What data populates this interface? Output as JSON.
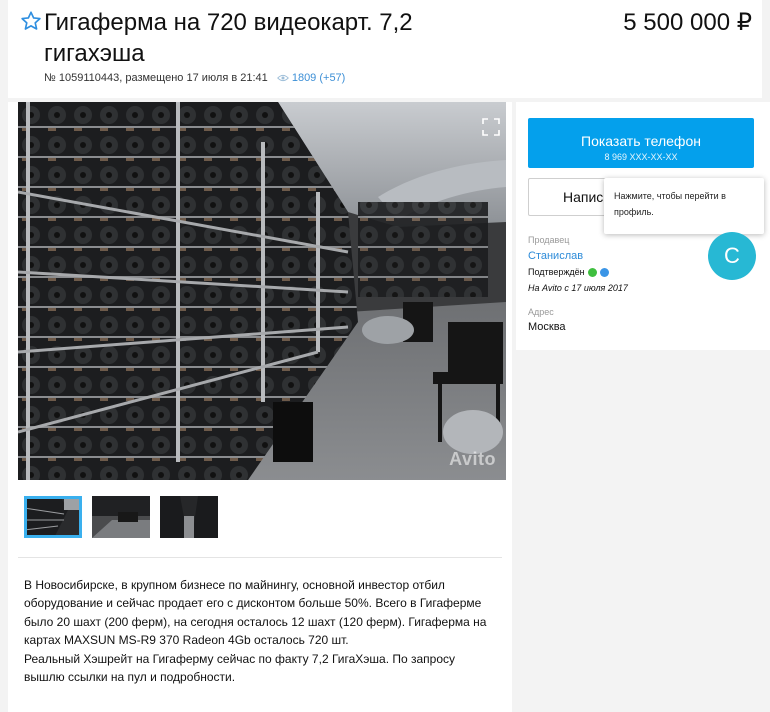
{
  "listing": {
    "title": "Гигаферма на 720 видеокарт. 7,2 гигахэша",
    "price": "5 500 000 ₽",
    "meta": "№ 1059110443, размещено 17 июля в 21:41",
    "views": "1809 (+57)"
  },
  "gallery": {
    "watermark": "Avito",
    "thumbnails": [
      "thumb-1",
      "thumb-2",
      "thumb-3"
    ],
    "active_index": 0
  },
  "description": {
    "paragraphs": [
      "В Новосибирске, в крупном бизнесе по майнингу, основной инвестор отбил оборудование и сейчас продает его с дисконтом больше 50%. Всего в Гигаферме было 20 шахт (200 ферм), на сегодня осталось 12 шахт (120 ферм). Гигаферма на картах MAXSUN MS-R9 370 Radeon 4Gb осталось 720 шт.",
      "Реальный Хэшрейт на Гигаферму сейчас по факту 7,2 ГигаХэша. По запросу вышлю ссылки на пул и подробности."
    ]
  },
  "contact": {
    "show_phone_label": "Показать телефон",
    "phone_masked": "8 969 XXX-XX-XX",
    "message_label": "Напис",
    "tooltip": "Нажмите, чтобы перейти в профиль.",
    "avatar_letter": "С"
  },
  "seller": {
    "label": "Продавец",
    "name": "Станислав",
    "verified": "Подтверждён",
    "since": "На Avito с 17 июля 2017"
  },
  "address": {
    "label": "Адрес",
    "value": "Москва"
  },
  "colors": {
    "accent": "#04a0ec",
    "link": "#2d8bd8",
    "avatar": "#27b8d4",
    "thumb_active": "#3ab0ee"
  },
  "icons": {
    "favorite": "star-outline-icon",
    "views": "eye-icon",
    "expand": "fullscreen-icon",
    "verified_phone": "whatsapp-icon",
    "verified_web": "globe-icon"
  }
}
